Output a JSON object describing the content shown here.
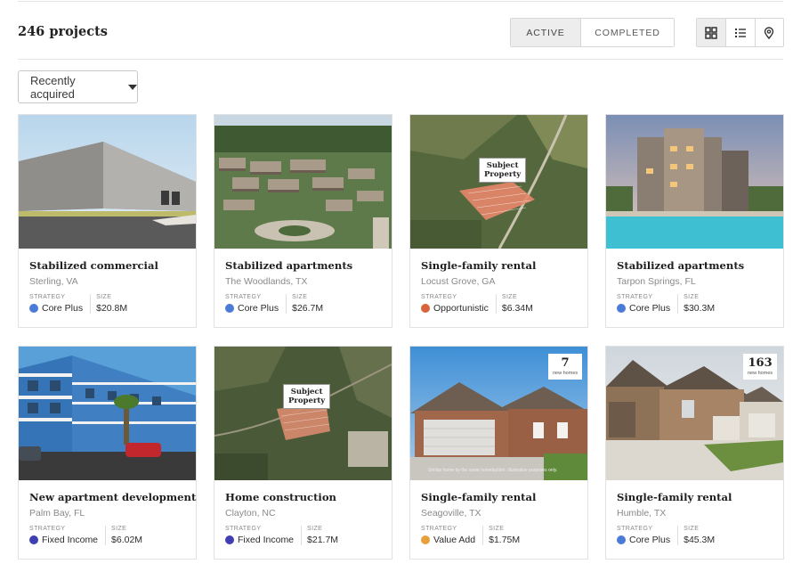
{
  "header": {
    "count": "246 projects",
    "tabs": [
      {
        "label": "ACTIVE"
      },
      {
        "label": "COMPLETED"
      }
    ],
    "sort_label": "Recently acquired"
  },
  "colors": {
    "core_plus": "#4a7bd6",
    "opportunistic": "#d9643a",
    "fixed_income": "#3f3fb3",
    "value_add": "#e8a13a"
  },
  "projects": [
    {
      "title": "Stabilized commercial",
      "location": "Sterling, VA",
      "strategy_label": "STRATEGY",
      "size_label": "SIZE",
      "strategy": "Core Plus",
      "size": "$20.8M",
      "image": "warehouse"
    },
    {
      "title": "Stabilized apartments",
      "location": "The Woodlands, TX",
      "strategy_label": "STRATEGY",
      "size_label": "SIZE",
      "strategy": "Core Plus",
      "size": "$26.7M",
      "image": "aerial-apartments"
    },
    {
      "title": "Single-family rental",
      "location": "Locust Grove, GA",
      "strategy_label": "STRATEGY",
      "size_label": "SIZE",
      "strategy": "Opportunistic",
      "size": "$6.34M",
      "image": "aerial-lot",
      "badge": "Subject Property"
    },
    {
      "title": "Stabilized apartments",
      "location": "Tarpon Springs, FL",
      "strategy_label": "STRATEGY",
      "size_label": "SIZE",
      "strategy": "Core Plus",
      "size": "$30.3M",
      "image": "pool-apartments"
    },
    {
      "title": "New apartment development",
      "location": "Palm Bay, FL",
      "strategy_label": "STRATEGY",
      "size_label": "SIZE",
      "strategy": "Fixed Income",
      "size": "$6.02M",
      "image": "blue-apartments"
    },
    {
      "title": "Home construction",
      "location": "Clayton, NC",
      "strategy_label": "STRATEGY",
      "size_label": "SIZE",
      "strategy": "Fixed Income",
      "size": "$21.7M",
      "image": "aerial-forest",
      "badge": "Subject Property"
    },
    {
      "title": "Single-family rental",
      "location": "Seagoville, TX",
      "strategy_label": "STRATEGY",
      "size_label": "SIZE",
      "strategy": "Value Add",
      "size": "$1.75M",
      "image": "brick-house",
      "homes_count": "7",
      "homes_label": "new homes",
      "disclaimer": "Similar home by the same homebuilder. Illustrative purposes only."
    },
    {
      "title": "Single-family rental",
      "location": "Humble, TX",
      "strategy_label": "STRATEGY",
      "size_label": "SIZE",
      "strategy": "Core Plus",
      "size": "$45.3M",
      "image": "stone-house",
      "homes_count": "163",
      "homes_label": "new homes"
    }
  ]
}
